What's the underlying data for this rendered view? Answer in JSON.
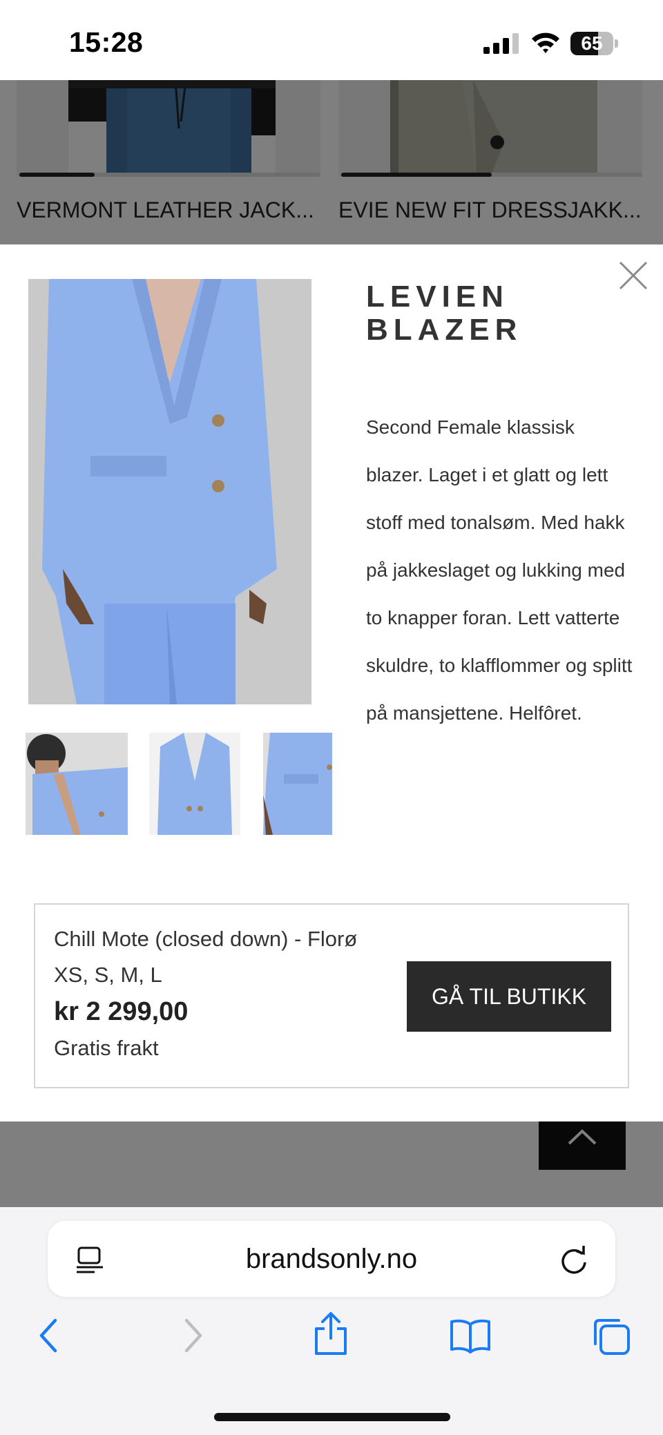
{
  "status_bar": {
    "time": "15:28",
    "battery_level": "65",
    "battery_fraction": 0.65,
    "signal_bars_active": 3
  },
  "background": {
    "cards": [
      {
        "title": "VERMONT LEATHER JACK...",
        "slider_fraction": 0.25
      },
      {
        "title": "EVIE NEW FIT DRESSJAKK...",
        "slider_fraction": 0.5
      }
    ]
  },
  "modal": {
    "title": "LEVIEN BLAZER",
    "description": "Second Female klassisk blazer. Laget i et glatt og lett stoff med tonalsøm. Med hakk på jakkeslaget og lukking med to knapper foran. Lett vatterte skuldre, to klafflommer og splitt på mansjettene. Helfôret.",
    "images": {
      "main": "blue-blazer-main-photo",
      "thumbnails": [
        "blazer-model-front-thumbnail",
        "blazer-product-thumbnail",
        "blazer-side-thumbnail"
      ]
    },
    "offer": {
      "shop_name": "Chill Mote (closed down) - Florø",
      "sizes": "XS, S, M, L",
      "price": "kr 2 299,00",
      "shipping": "Gratis frakt",
      "button_label": "GÅ TIL BUTIKK"
    }
  },
  "browser": {
    "url": "brandsonly.no"
  },
  "colors": {
    "accent_blue": "#1a7cf2",
    "blazer_blue": "#8fb1ec",
    "button_dark": "#2a2a2a",
    "text_dark": "#333333"
  }
}
